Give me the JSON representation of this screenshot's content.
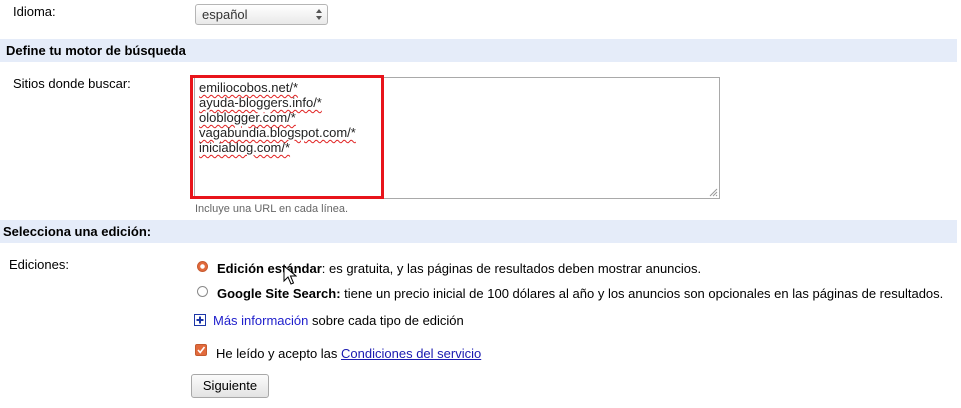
{
  "language": {
    "label": "Idioma:",
    "selected": "español"
  },
  "search_engine_section": {
    "title": "Define tu motor de búsqueda",
    "sites_label": "Sitios donde buscar:",
    "sites": [
      "emiliocobos.net/*",
      "ayuda-bloggers.info/*",
      "oloblogger.com/*",
      "vagabundia.blogspot.com/*",
      "iniciablog.com/*"
    ],
    "hint": "Incluye una URL en cada línea."
  },
  "edition_section": {
    "title": "Selecciona una edición:",
    "editions_label": "Ediciones:",
    "options": [
      {
        "name": "Edición estándar",
        "description": ": es gratuita, y las páginas de resultados deben mostrar anuncios.",
        "selected": true
      },
      {
        "name": "Google Site Search:",
        "description": " tiene un precio inicial de 100 dólares al año y los anuncios son opcionales en las páginas de resultados.",
        "selected": false
      }
    ],
    "more_info_link": "Más información",
    "more_info_suffix": " sobre cada tipo de edición",
    "terms_prefix": "He leído y acepto las ",
    "terms_link": "Condiciones del servicio",
    "terms_checked": true,
    "next_button": "Siguiente"
  },
  "colors": {
    "section_bg": "#e5ecf9",
    "highlight_box": "#e8141b",
    "accent": "#e26a3c",
    "link": "#2020cc"
  }
}
